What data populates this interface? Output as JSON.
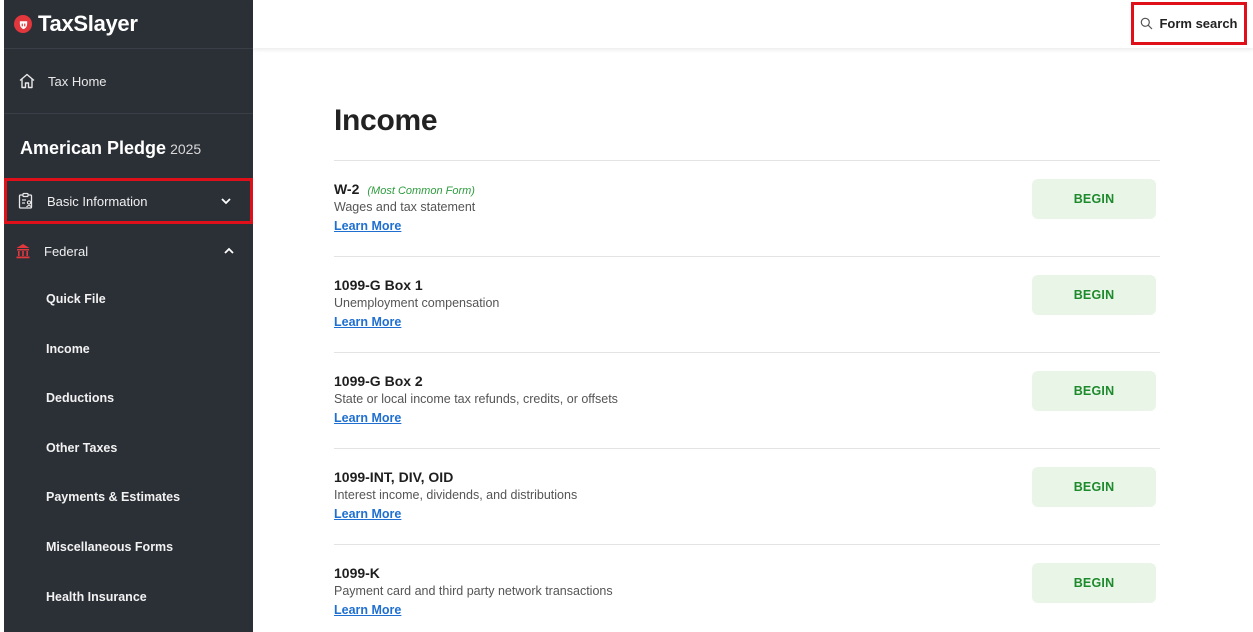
{
  "brand": {
    "name": "TaxSlayer"
  },
  "colors": {
    "sidebar_bg": "#2b2f36",
    "accent_red": "#e2373d",
    "highlight_red": "#e0101a",
    "begin_bg": "#e9f5e6",
    "begin_text": "#1e8a2e",
    "link": "#1f6fd0",
    "tag_green": "#2e9c3f"
  },
  "sidebar": {
    "tax_home": "Tax Home",
    "return_name": "American Pledge",
    "return_year": "2025",
    "basic_information": "Basic Information",
    "federal": "Federal",
    "federal_items": [
      {
        "label": "Quick File"
      },
      {
        "label": "Income"
      },
      {
        "label": "Deductions"
      },
      {
        "label": "Other Taxes"
      },
      {
        "label": "Payments & Estimates"
      },
      {
        "label": "Miscellaneous Forms"
      },
      {
        "label": "Health Insurance"
      }
    ]
  },
  "topbar": {
    "form_search": "Form search"
  },
  "main": {
    "title": "Income",
    "rows": [
      {
        "form": "W-2",
        "tag": "(Most Common Form)",
        "desc": "Wages and tax statement",
        "learn_more": "Learn More",
        "button": "BEGIN"
      },
      {
        "form": "1099-G Box 1",
        "tag": "",
        "desc": "Unemployment compensation",
        "learn_more": "Learn More",
        "button": "BEGIN"
      },
      {
        "form": "1099-G Box 2",
        "tag": "",
        "desc": "State or local income tax refunds, credits, or offsets",
        "learn_more": "Learn More",
        "button": "BEGIN"
      },
      {
        "form": "1099-INT, DIV, OID",
        "tag": "",
        "desc": "Interest income, dividends, and distributions",
        "learn_more": "Learn More",
        "button": "BEGIN"
      },
      {
        "form": "1099-K",
        "tag": "",
        "desc": "Payment card and third party network transactions",
        "learn_more": "Learn More",
        "button": "BEGIN"
      }
    ]
  }
}
